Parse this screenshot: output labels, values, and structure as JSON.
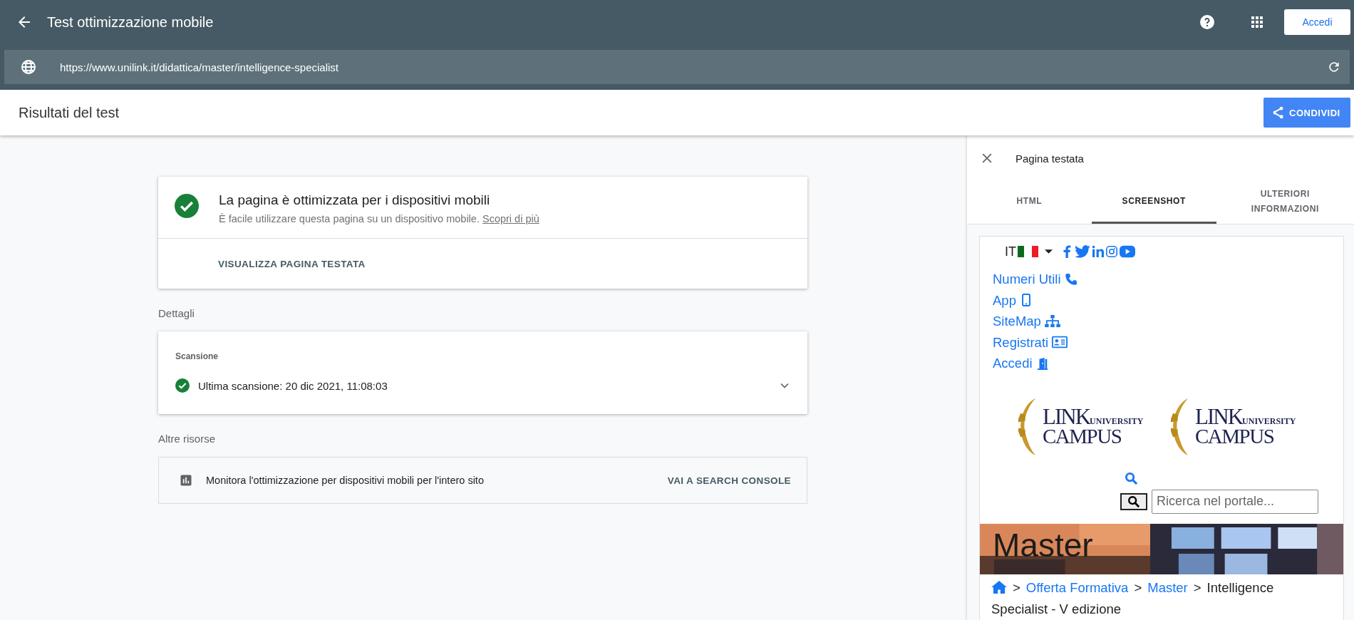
{
  "header": {
    "title": "Test ottimizzazione mobile",
    "signin": "Accedi"
  },
  "url_bar": {
    "value": "https://www.unilink.it/didattica/master/intelligence-specialist"
  },
  "results_bar": {
    "title": "Risultati del test",
    "share": "CONDIVIDI"
  },
  "summary_card": {
    "heading": "La pagina è ottimizzata per i dispositivi mobili",
    "description": "È facile utilizzare questa pagina su un dispositivo mobile.",
    "link": "Scopri di più",
    "action": "VISUALIZZA PAGINA TESTATA"
  },
  "details": {
    "heading": "Dettagli",
    "section": "Scansione",
    "crawl": "Ultima scansione: 20 dic 2021, 11:08:03",
    "expanded": false
  },
  "resources": {
    "heading": "Altre risorse",
    "text": "Monitora l'ottimizzazione per dispositivi mobili per l'intero sito",
    "action": "VAI A SEARCH CONSOLE"
  },
  "panel": {
    "title": "Pagina testata",
    "tabs": [
      {
        "label": "HTML",
        "selected": false
      },
      {
        "label": "SCREENSHOT",
        "selected": true
      },
      {
        "label": "ULTERIORI INFORMAZIONI",
        "selected": false
      }
    ],
    "preview": {
      "language": "IT",
      "links": [
        "Numeri Utili",
        "App",
        "SiteMap",
        "Registrati",
        "Accedi"
      ],
      "logos": [
        {
          "name": "LINK",
          "sub": "UNIVERSITY",
          "bottom": "CAMPUS"
        },
        {
          "name": "LINK",
          "sub": "UNIVERSITY",
          "bottom": "CAMPUS"
        }
      ],
      "search_placeholder": "Ricerca nel portale...",
      "banner_title": "Master",
      "breadcrumb": [
        {
          "kind": "home"
        },
        {
          "kind": "separator",
          "label": ">"
        },
        {
          "kind": "link",
          "label": "Offerta Formativa"
        },
        {
          "kind": "separator",
          "label": ">"
        },
        {
          "kind": "link",
          "label": "Master"
        },
        {
          "kind": "separator",
          "label": ">"
        },
        {
          "kind": "current",
          "label": "Intelligence Specialist - V edizione"
        }
      ]
    }
  }
}
